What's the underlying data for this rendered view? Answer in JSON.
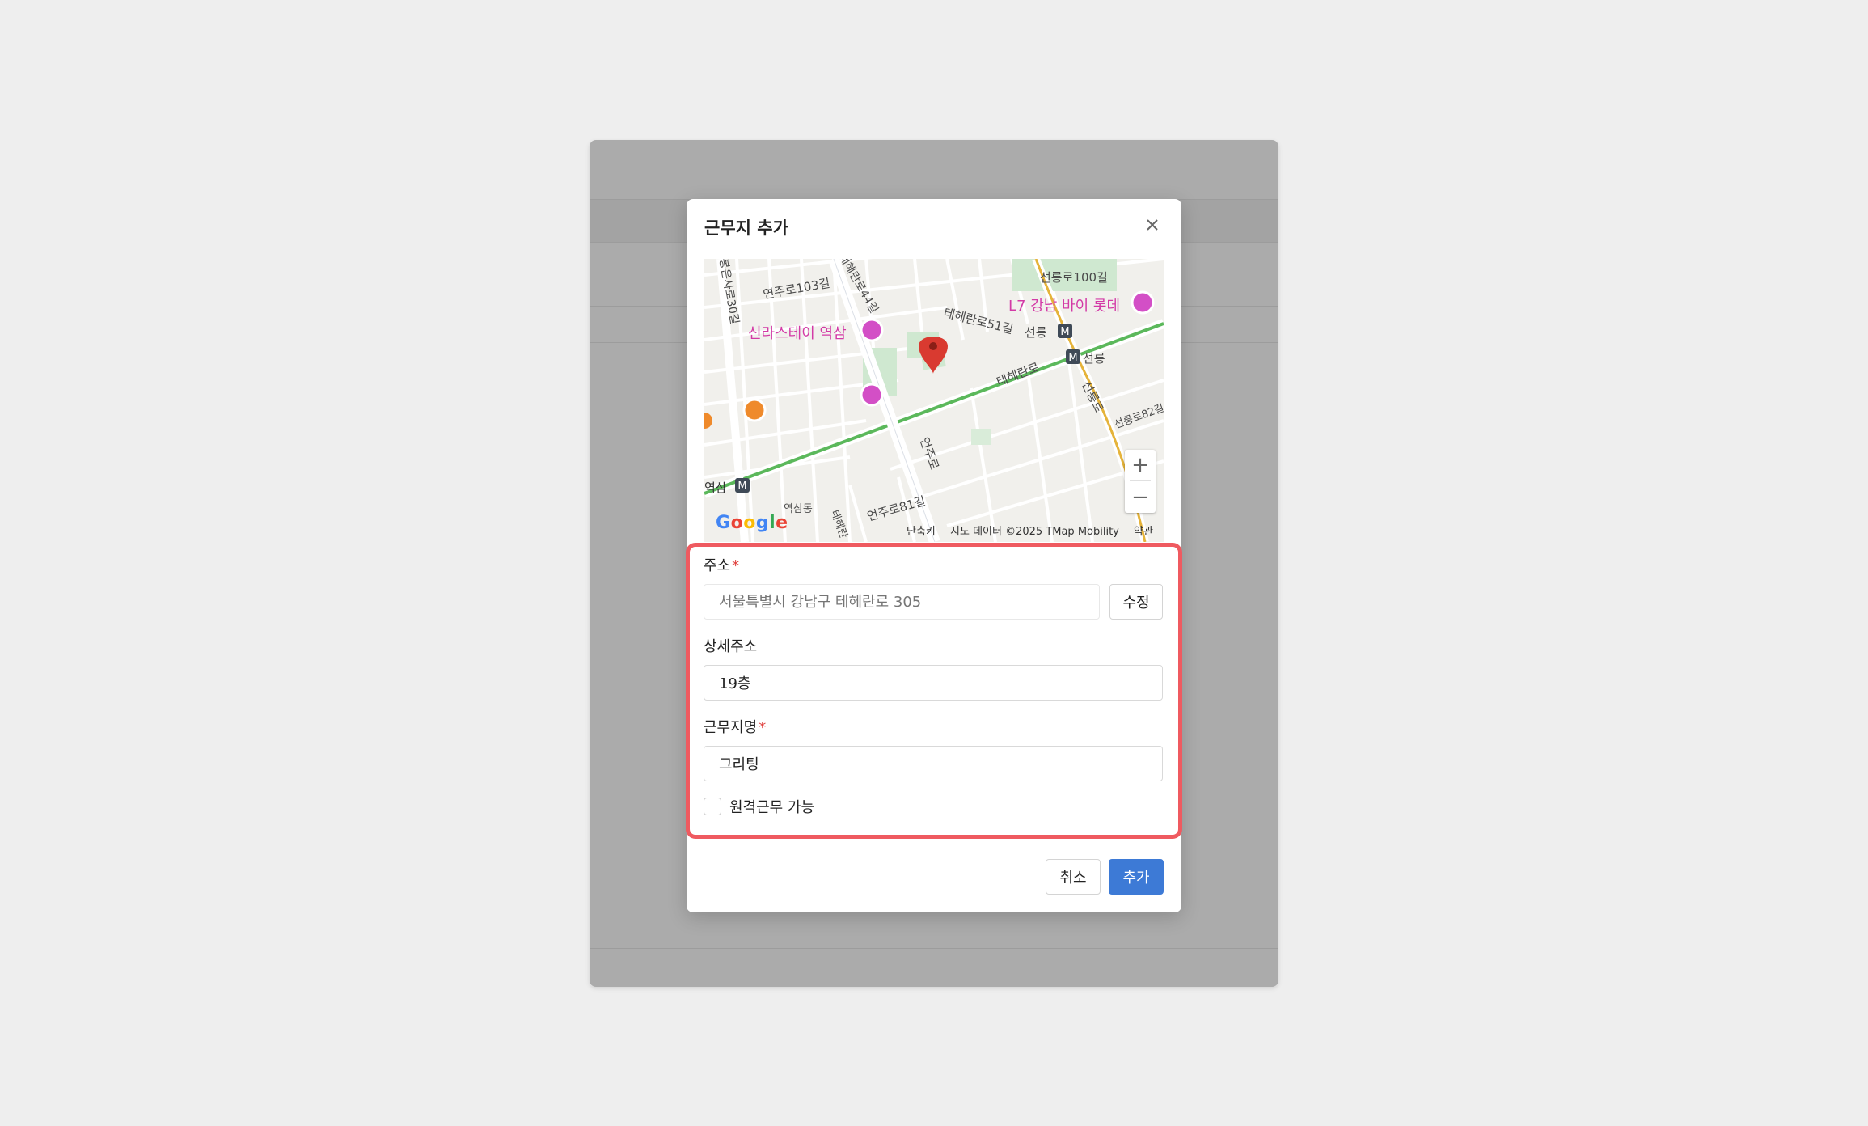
{
  "modal": {
    "title": "근무지 추가",
    "close_icon": "close-icon"
  },
  "map": {
    "labels": {
      "seolleung100": "선릉로100길",
      "l7": "L7 강남 바이 롯데",
      "yeonju103": "연주로103길",
      "silla": "신라스테이 역삼",
      "teheran51": "테헤란로51길",
      "seolleung_station1": "선릉",
      "seolleung_station2": "선릉",
      "teheranro": "테헤란로",
      "seolleungro": "선릉로",
      "seolleung82": "선릉로82길",
      "yeonjuro": "언주로",
      "yeoksam": "역삼",
      "yeoksamdong": "역삼동",
      "yeonju81": "언주로81길",
      "teheran44": "테헤란로44길",
      "bongeunsa30": "봉은사로30길",
      "teheran_small": "테헤란"
    },
    "google": "Google",
    "footer": {
      "shortcuts": "단축키",
      "data": "지도 데이터 ©2025 TMap Mobility",
      "terms": "약관"
    },
    "zoom_in": "+",
    "zoom_out": "−"
  },
  "form": {
    "address_label": "주소",
    "required_mark": "*",
    "address_placeholder": "서울특별시 강남구 테헤란로 305",
    "edit_button": "수정",
    "detail_label": "상세주소",
    "detail_value": "19층",
    "workplace_label": "근무지명",
    "workplace_value": "그리팅",
    "remote_label": "원격근무 가능"
  },
  "footer": {
    "cancel": "취소",
    "add": "추가"
  },
  "colors": {
    "primary": "#3d7ad6",
    "highlight": "#ef5a60",
    "required": "#e0413e"
  }
}
